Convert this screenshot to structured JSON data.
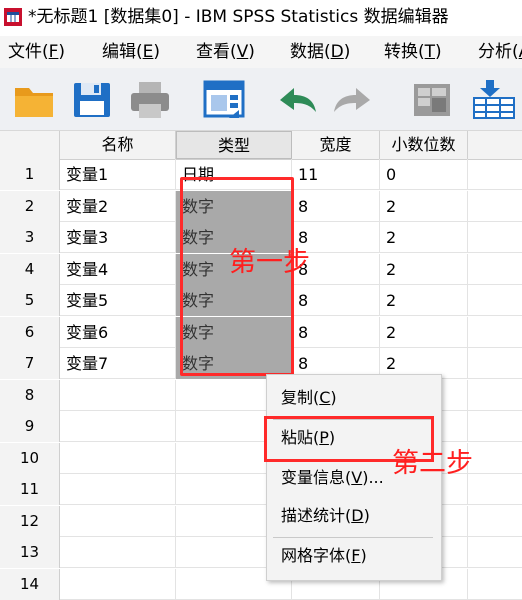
{
  "window": {
    "title": "*无标题1 [数据集0] - IBM SPSS Statistics 数据编辑器"
  },
  "menu": [
    {
      "label": "文件",
      "key": "F"
    },
    {
      "label": "编辑",
      "key": "E"
    },
    {
      "label": "查看",
      "key": "V"
    },
    {
      "label": "数据",
      "key": "D"
    },
    {
      "label": "转换",
      "key": "T"
    },
    {
      "label": "分析",
      "key": "A"
    }
  ],
  "toolbar": {
    "icons": [
      "open-folder-icon",
      "save-icon",
      "print-icon",
      "recall-dialog-icon",
      "undo-icon",
      "redo-icon",
      "goto-case-icon",
      "insert-variable-icon"
    ]
  },
  "grid": {
    "columns": [
      "名称",
      "类型",
      "宽度",
      "小数位数"
    ],
    "rows": [
      {
        "num": "1",
        "name": "变量1",
        "type": "日期",
        "width": "11",
        "decimals": "0"
      },
      {
        "num": "2",
        "name": "变量2",
        "type": "数字",
        "width": "8",
        "decimals": "2"
      },
      {
        "num": "3",
        "name": "变量3",
        "type": "数字",
        "width": "8",
        "decimals": "2"
      },
      {
        "num": "4",
        "name": "变量4",
        "type": "数字",
        "width": "8",
        "decimals": "2"
      },
      {
        "num": "5",
        "name": "变量5",
        "type": "数字",
        "width": "8",
        "decimals": "2"
      },
      {
        "num": "6",
        "name": "变量6",
        "type": "数字",
        "width": "8",
        "decimals": "2"
      },
      {
        "num": "7",
        "name": "变量7",
        "type": "数字",
        "width": "8",
        "decimals": "2"
      },
      {
        "num": "8",
        "name": "",
        "type": "",
        "width": "",
        "decimals": ""
      },
      {
        "num": "9",
        "name": "",
        "type": "",
        "width": "",
        "decimals": ""
      },
      {
        "num": "10",
        "name": "",
        "type": "",
        "width": "",
        "decimals": ""
      },
      {
        "num": "11",
        "name": "",
        "type": "",
        "width": "",
        "decimals": ""
      },
      {
        "num": "12",
        "name": "",
        "type": "",
        "width": "",
        "decimals": ""
      },
      {
        "num": "13",
        "name": "",
        "type": "",
        "width": "",
        "decimals": ""
      },
      {
        "num": "14",
        "name": "",
        "type": "",
        "width": "",
        "decimals": ""
      }
    ]
  },
  "context_menu": {
    "items": [
      {
        "label": "复制(",
        "key": "C",
        "suffix": ")"
      },
      {
        "label": "粘贴(",
        "key": "P",
        "suffix": ")"
      },
      {
        "label": "变量信息(",
        "key": "V",
        "suffix": ")..."
      },
      {
        "label": "描述统计(",
        "key": "D",
        "suffix": ")"
      },
      {
        "label": "网格字体(",
        "key": "F",
        "suffix": ")"
      }
    ]
  },
  "annotations": {
    "step1": "第一步",
    "step2": "第二步"
  },
  "colors": {
    "annotation": "#ff1f1f",
    "selection": "#a9a9a9",
    "toolbar_blue": "#1f6fc5",
    "undo_green": "#2e8b57"
  }
}
